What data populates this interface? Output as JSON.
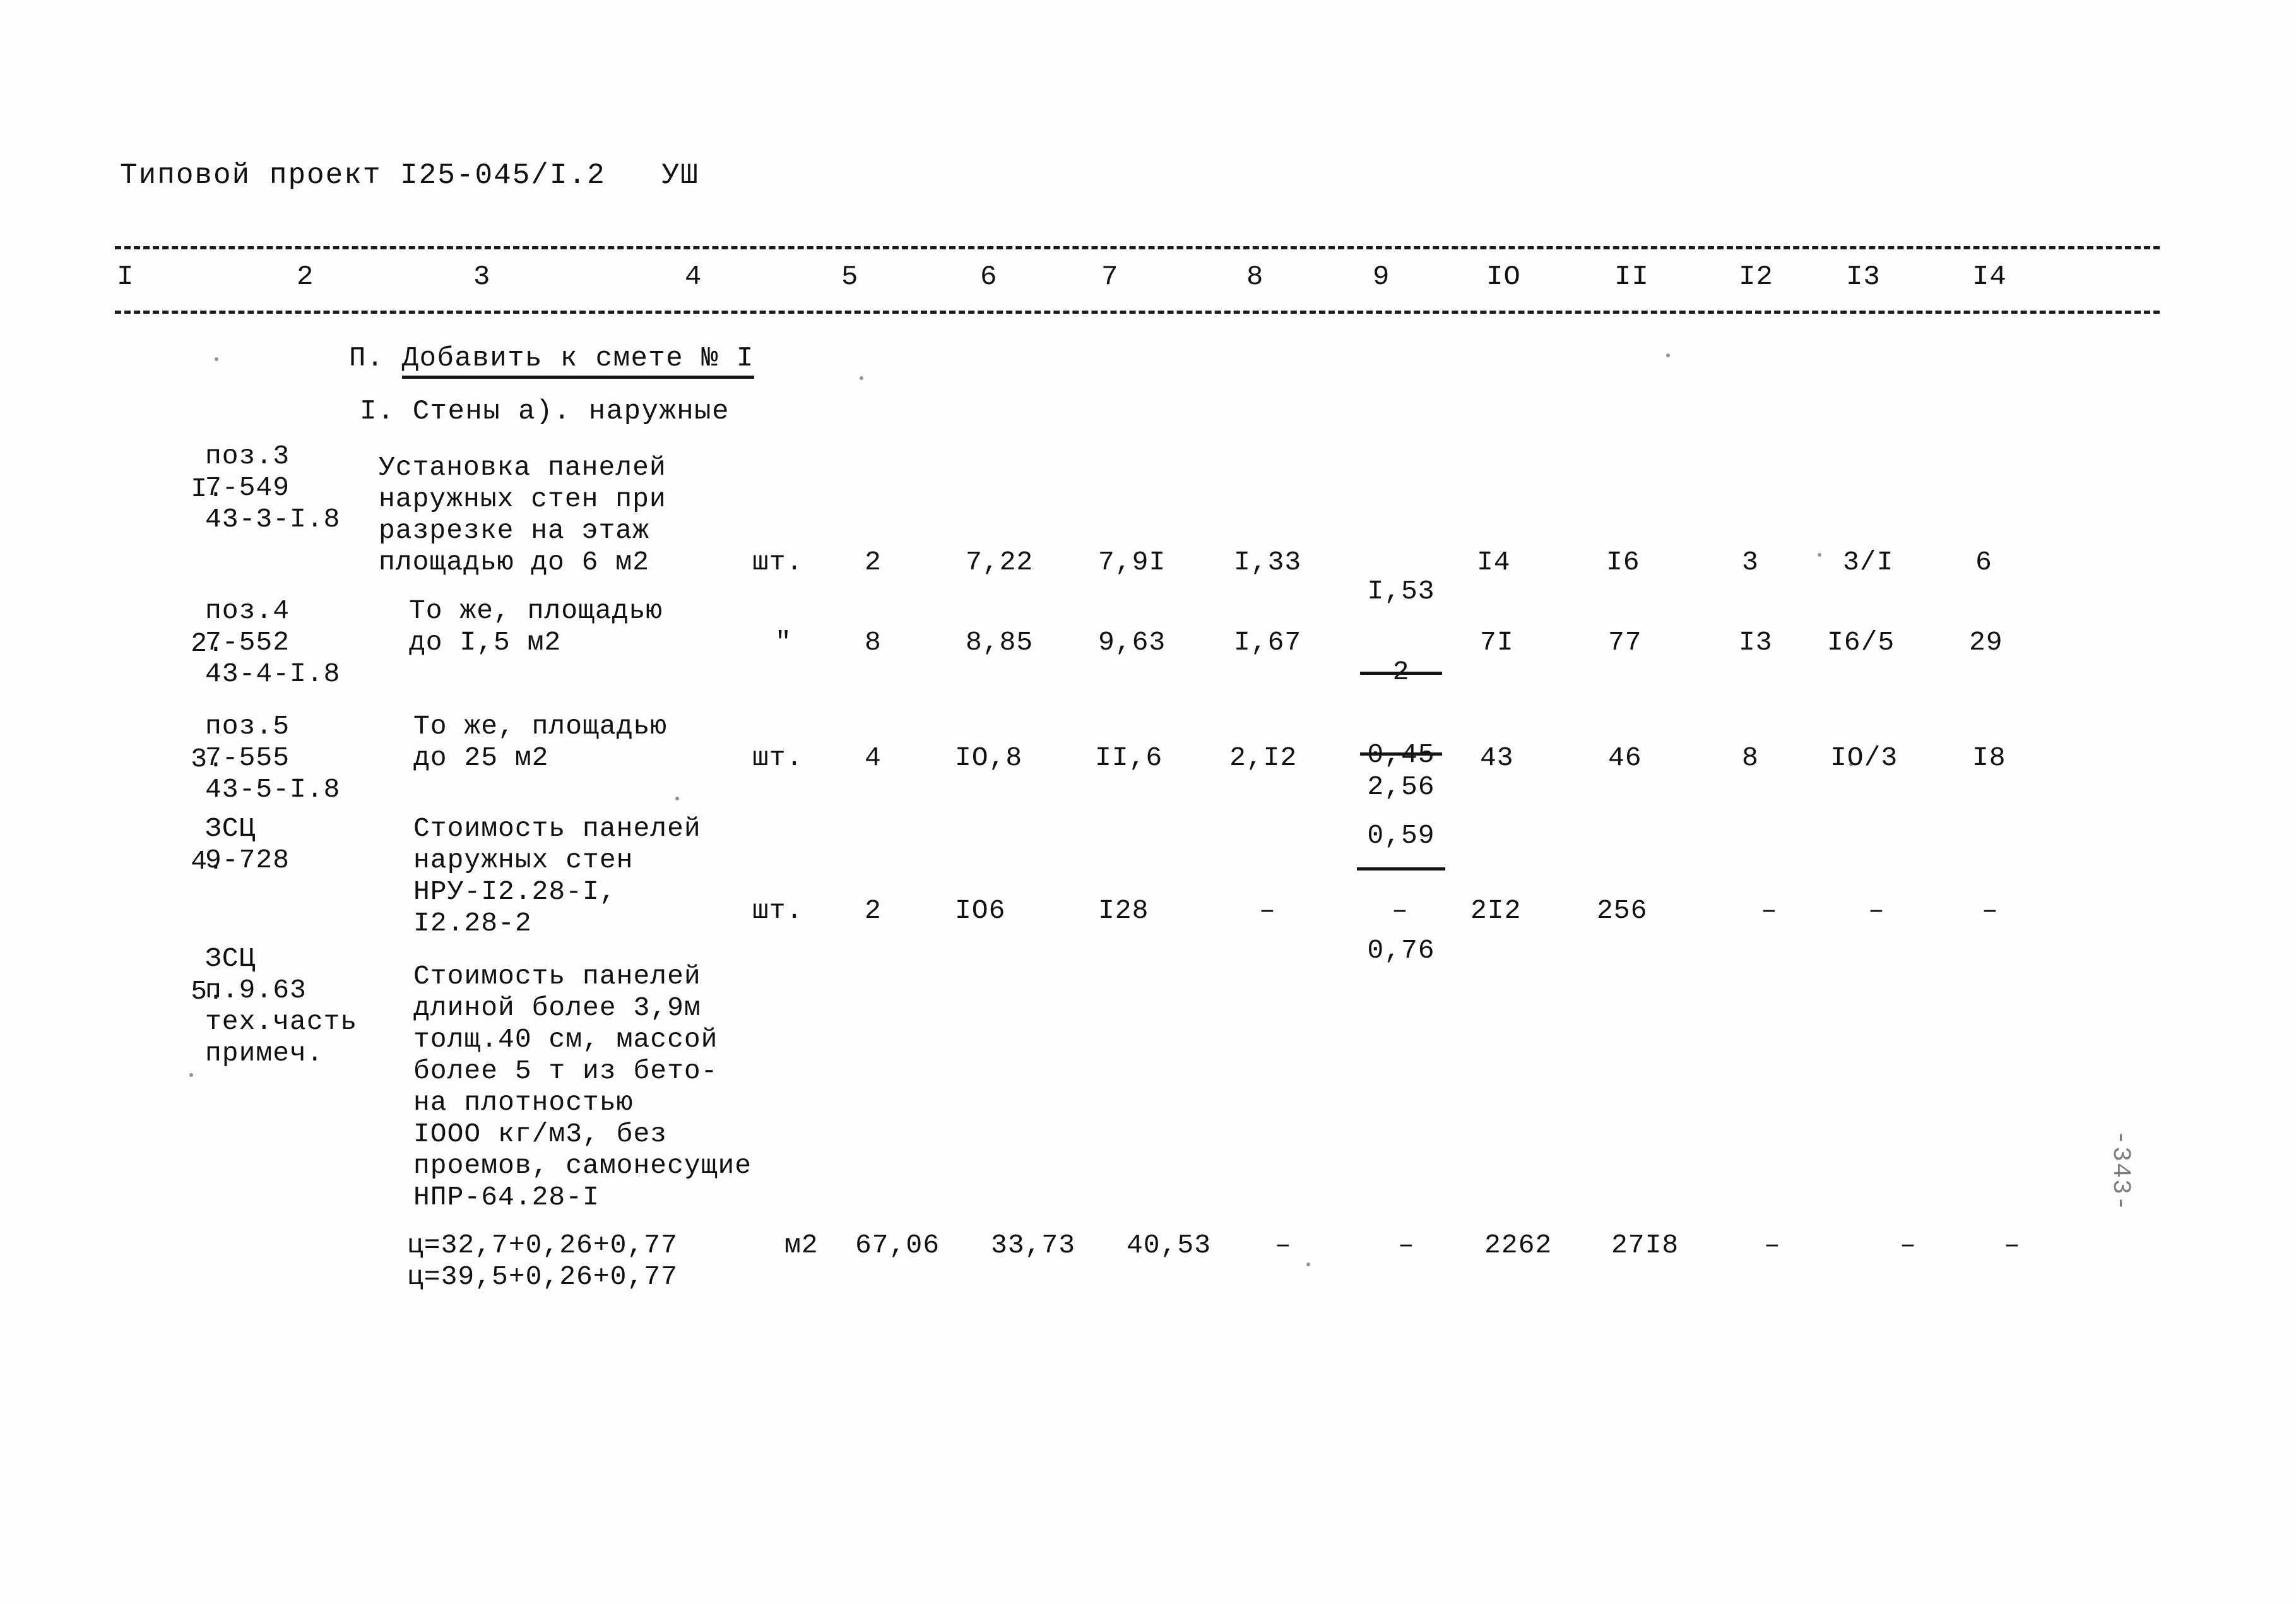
{
  "document": {
    "title": "Типовой проект I25-045/I.2   УШ",
    "page_mark": "-343-"
  },
  "table": {
    "column_numbers": [
      "I",
      "2",
      "3",
      "4",
      "5",
      "6",
      "7",
      "8",
      "9",
      "IO",
      "II",
      "I2",
      "I3",
      "I4"
    ],
    "headings": {
      "main": "П. Добавить к смете № I",
      "main_prefix": "П. ",
      "main_underlined": "Добавить к смете № I",
      "sub": "I. Стены а). наружные"
    },
    "rows": [
      {
        "no": "I.",
        "code_lines": [
          "поз.3",
          "7-549",
          "43-3-I.8"
        ],
        "desc_lines": [
          "Установка панелей",
          "наружных стен при",
          "разрезке на этаж",
          "площадью до 6 м2"
        ],
        "unit": "шт.",
        "c5": "2",
        "c6": "7,22",
        "c7": "7,9I",
        "c8": "I,33",
        "c9_top": "I,53",
        "c9_bot": "0,45",
        "c10": "I4",
        "c11": "I6",
        "c12": "3",
        "c13": "3/I",
        "c14": "6"
      },
      {
        "no": "2.",
        "code_lines": [
          "поз.4",
          "7-552",
          "43-4-I.8"
        ],
        "desc_lines": [
          "То же, площадью",
          "до I,5 м2"
        ],
        "unit": "\"",
        "c5": "8",
        "c6": "8,85",
        "c7": "9,63",
        "c8": "I,67",
        "c9_top": "2",
        "c9_bot": "0,59",
        "c10": "7I",
        "c11": "77",
        "c12": "I3",
        "c13": "I6/5",
        "c14": "29"
      },
      {
        "no": "3.",
        "code_lines": [
          "поз.5",
          "7-555",
          "43-5-I.8"
        ],
        "desc_lines": [
          "То же, площадью",
          "до 25 м2"
        ],
        "unit": "шт.",
        "c5": "4",
        "c6": "IO,8",
        "c7": "II,6",
        "c8": "2,I2",
        "c9_top": "2,56",
        "c9_bot": "0,76",
        "c10": "43",
        "c11": "46",
        "c12": "8",
        "c13": "IO/3",
        "c14": "I8"
      },
      {
        "no": "4.",
        "code_lines": [
          "ЗСЦ",
          "9-728"
        ],
        "desc_lines": [
          "Стоимость панелей",
          "наружных стен",
          "НРУ-I2.28-I,",
          "I2.28-2"
        ],
        "unit": "шт.",
        "c5": "2",
        "c6": "IO6",
        "c7": "I28",
        "c8": "–",
        "c9": "–",
        "c10": "2I2",
        "c11": "256",
        "c12": "–",
        "c13": "–",
        "c14": "–"
      },
      {
        "no": "5.",
        "code_lines": [
          "ЗСЦ",
          "п.9.63",
          "тех.часть",
          "примеч."
        ],
        "desc_lines": [
          "Стоимость панелей",
          "длиной более 3,9м",
          "толщ.40 см, массой",
          "более 5 т из бето-",
          "на плотностью",
          "IOOO кг/м3, без",
          "проемов, самонесущие",
          "НПР-64.28-I"
        ],
        "formula_lines": [
          "ц=32,7+0,26+0,77",
          "ц=39,5+0,26+0,77"
        ],
        "unit": "м2",
        "c5": "67,06",
        "c6": "33,73",
        "c7": "40,53",
        "c8": "–",
        "c9": "–",
        "c10": "2262",
        "c11": "27I8",
        "c12": "–",
        "c13": "–",
        "c14": "–"
      }
    ]
  }
}
